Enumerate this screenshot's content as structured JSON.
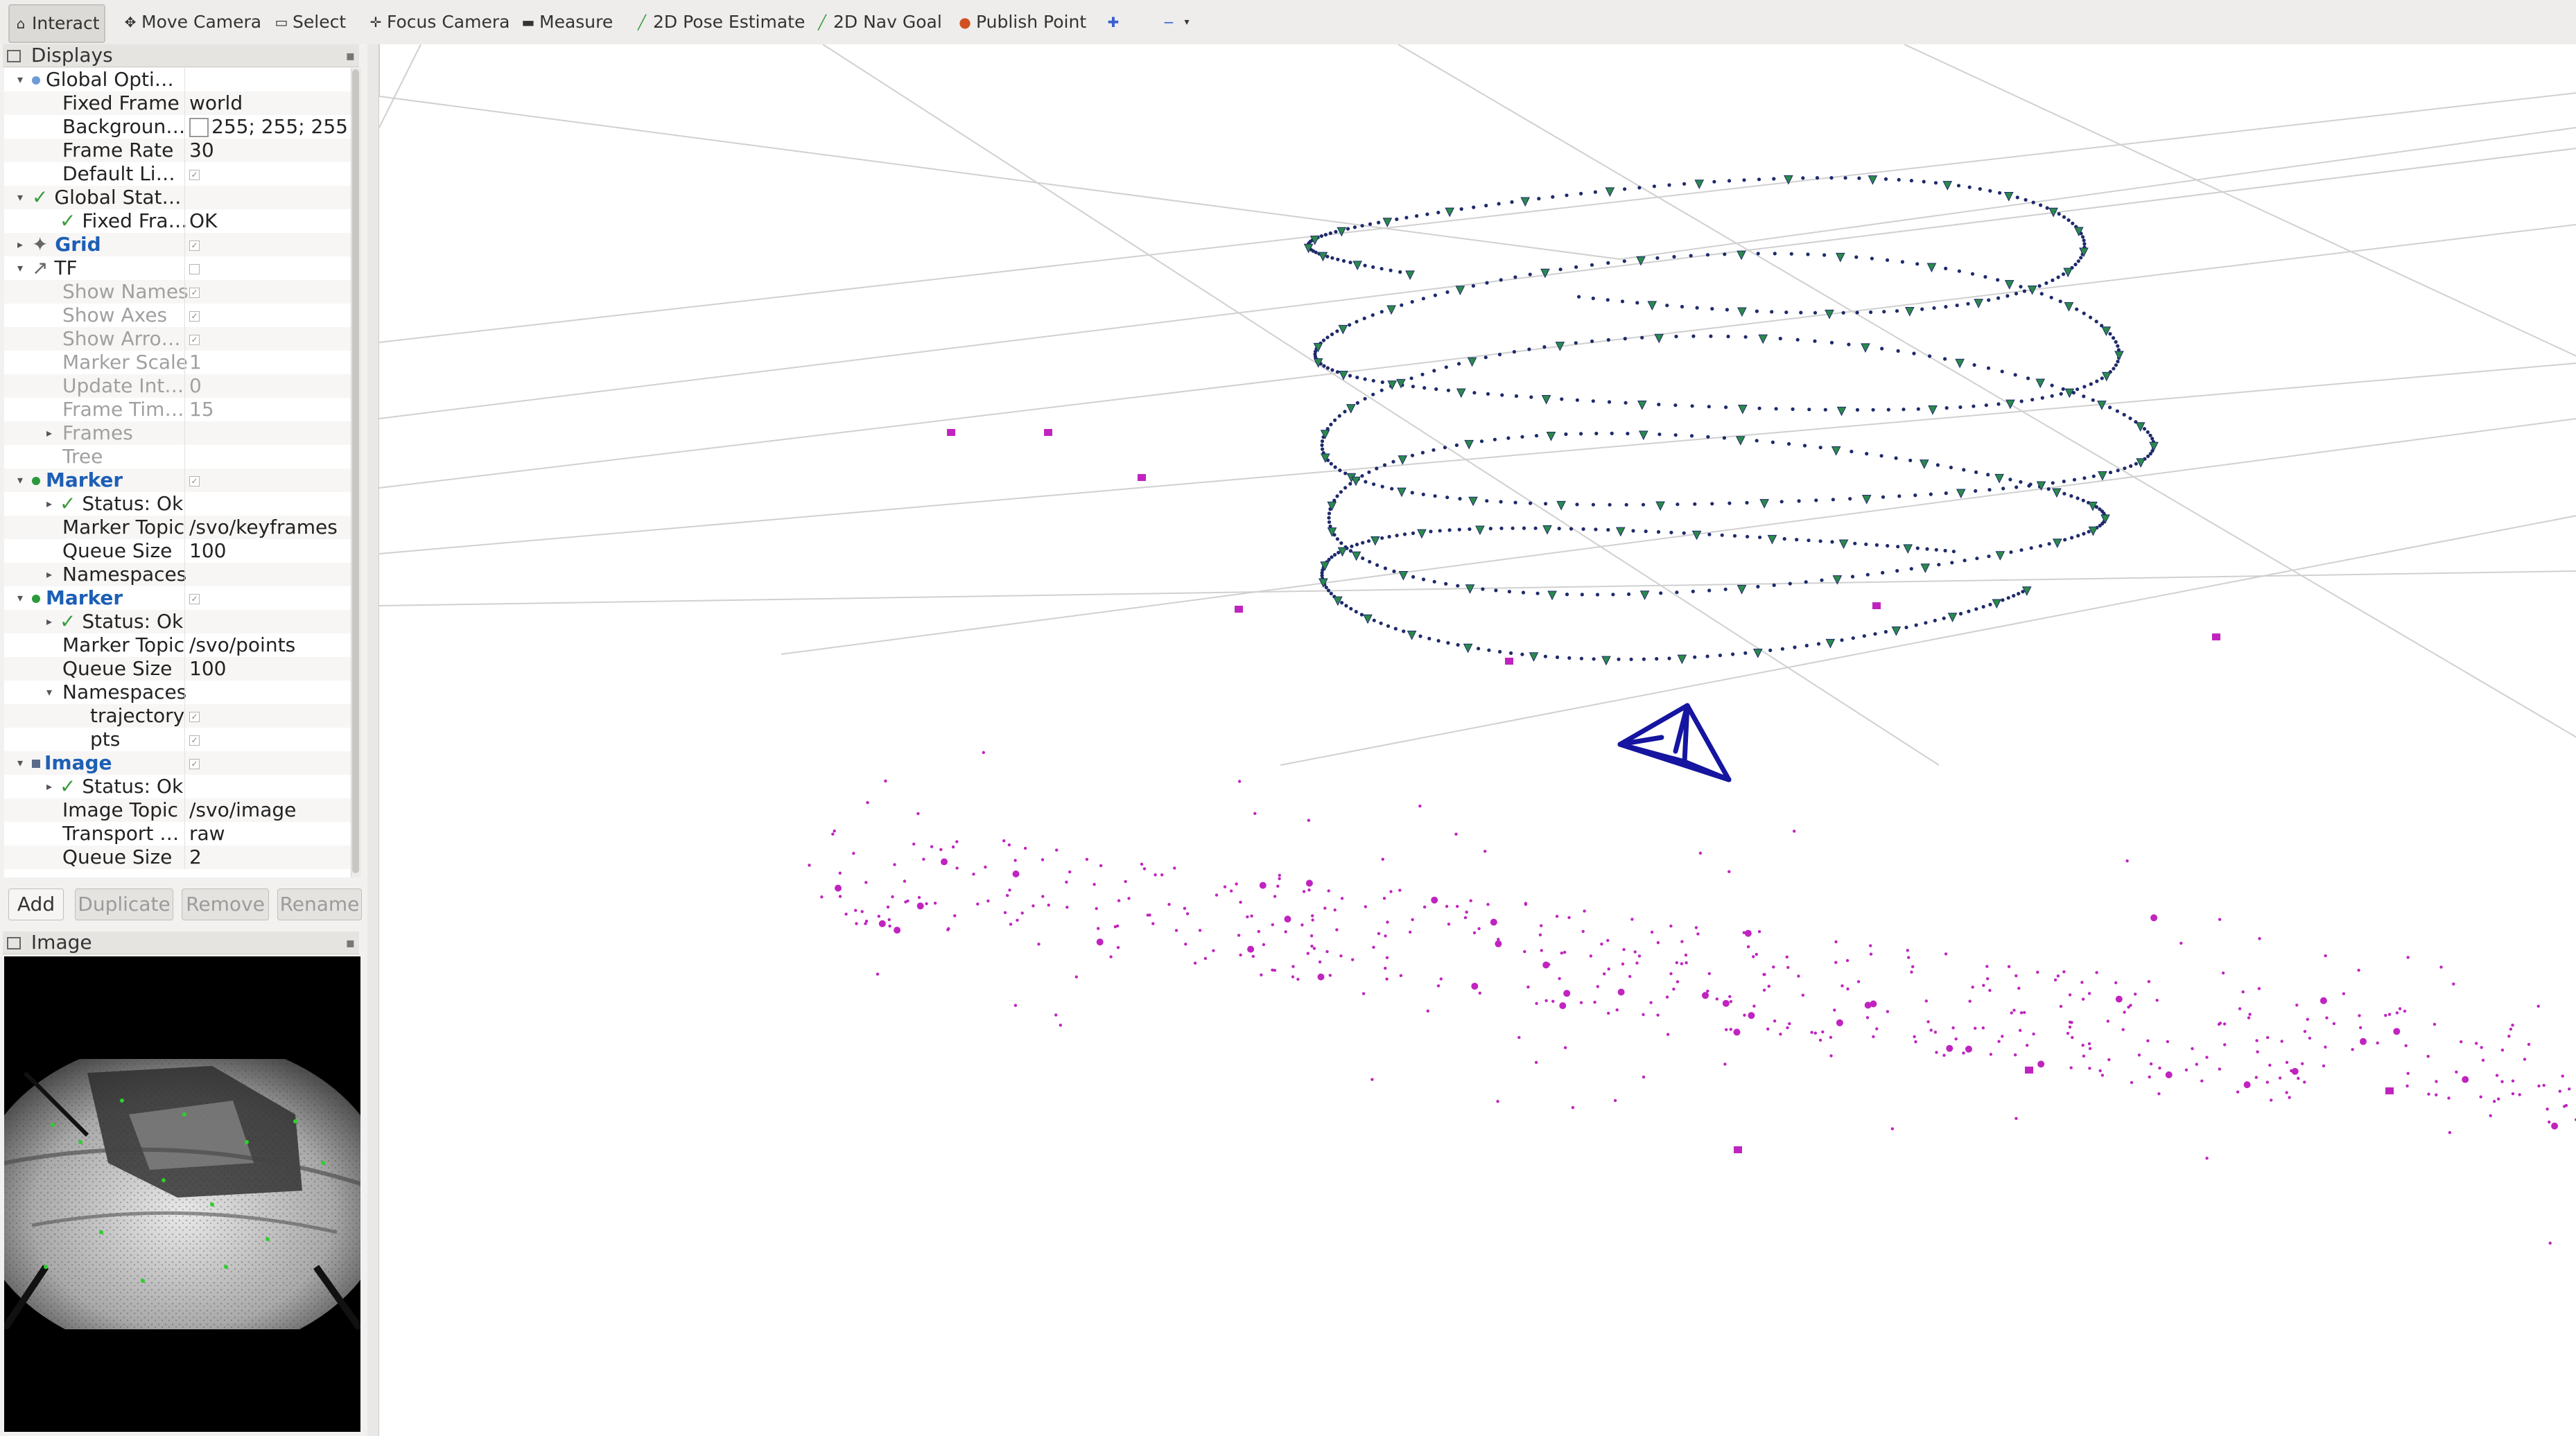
{
  "toolbar": {
    "tools": [
      {
        "label": "Interact",
        "icon": "cursor-icon",
        "active": true
      },
      {
        "label": "Move Camera",
        "icon": "move-icon"
      },
      {
        "label": "Select",
        "icon": "select-icon"
      },
      {
        "label": "Focus Camera",
        "icon": "crosshair-icon"
      },
      {
        "label": "Measure",
        "icon": "ruler-icon"
      },
      {
        "label": "2D Pose Estimate",
        "icon": "pose-arrow-icon"
      },
      {
        "label": "2D Nav Goal",
        "icon": "nav-arrow-icon"
      },
      {
        "label": "Publish Point",
        "icon": "pin-icon"
      }
    ]
  },
  "displays_panel": {
    "title": "Displays",
    "rows": [
      {
        "name": "Global Opti…",
        "value": "",
        "kind": "group",
        "icon": "globe-icon"
      },
      {
        "name": "Fixed Frame",
        "value": "world"
      },
      {
        "name": "Backgroun…",
        "value": "255; 255; 255",
        "swatch": "#ffffff"
      },
      {
        "name": "Frame Rate",
        "value": "30"
      },
      {
        "name": "Default Li…",
        "value": "",
        "check": true
      },
      {
        "name": "Global Stat…",
        "value": "",
        "kind": "group",
        "status": "ok"
      },
      {
        "name": "Fixed Fra…",
        "value": "OK",
        "status": "ok"
      },
      {
        "name": "Grid",
        "value": "",
        "kind": "display",
        "check": true
      },
      {
        "name": "TF",
        "value": "",
        "kind": "display",
        "check": false
      },
      {
        "name": "Show Names",
        "value": "",
        "dim": true,
        "check": true
      },
      {
        "name": "Show Axes",
        "value": "",
        "dim": true,
        "check": true
      },
      {
        "name": "Show Arro…",
        "value": "",
        "dim": true,
        "check": true
      },
      {
        "name": "Marker Scale",
        "value": "1",
        "dim": true
      },
      {
        "name": "Update Int…",
        "value": "0",
        "dim": true
      },
      {
        "name": "Frame Tim…",
        "value": "15",
        "dim": true
      },
      {
        "name": "Frames",
        "value": "",
        "dim": true
      },
      {
        "name": "Tree",
        "value": "",
        "dim": true
      },
      {
        "name": "Marker",
        "value": "",
        "kind": "display",
        "check": true
      },
      {
        "name": "Status: Ok",
        "value": "",
        "status": "ok"
      },
      {
        "name": "Marker Topic",
        "value": "/svo/keyframes"
      },
      {
        "name": "Queue Size",
        "value": "100"
      },
      {
        "name": "Namespaces",
        "value": ""
      },
      {
        "name": "Marker",
        "value": "",
        "kind": "display",
        "check": true
      },
      {
        "name": "Status: Ok",
        "value": "",
        "status": "ok"
      },
      {
        "name": "Marker Topic",
        "value": "/svo/points"
      },
      {
        "name": "Queue Size",
        "value": "100"
      },
      {
        "name": "Namespaces",
        "value": ""
      },
      {
        "name": "trajectory",
        "value": "",
        "check": true
      },
      {
        "name": "pts",
        "value": "",
        "check": true
      },
      {
        "name": "Image",
        "value": "",
        "kind": "display",
        "check": true
      },
      {
        "name": "Status: Ok",
        "value": "",
        "status": "ok"
      },
      {
        "name": "Image Topic",
        "value": "/svo/image"
      },
      {
        "name": "Transport …",
        "value": "raw"
      },
      {
        "name": "Queue Size",
        "value": "2"
      }
    ],
    "buttons": {
      "add": "Add",
      "duplicate": "Duplicate",
      "remove": "Remove",
      "rename": "Rename"
    }
  },
  "image_panel": {
    "title": "Image"
  },
  "colors": {
    "trajectory": "#1f2a6b",
    "keyframe": "#2a8a4a",
    "points": "#c024c0",
    "camera_frustum": "#1515a0",
    "grid": "#d0d0d0",
    "check_ok": "#3a9a3a",
    "display_name": "#1d5fb5"
  }
}
